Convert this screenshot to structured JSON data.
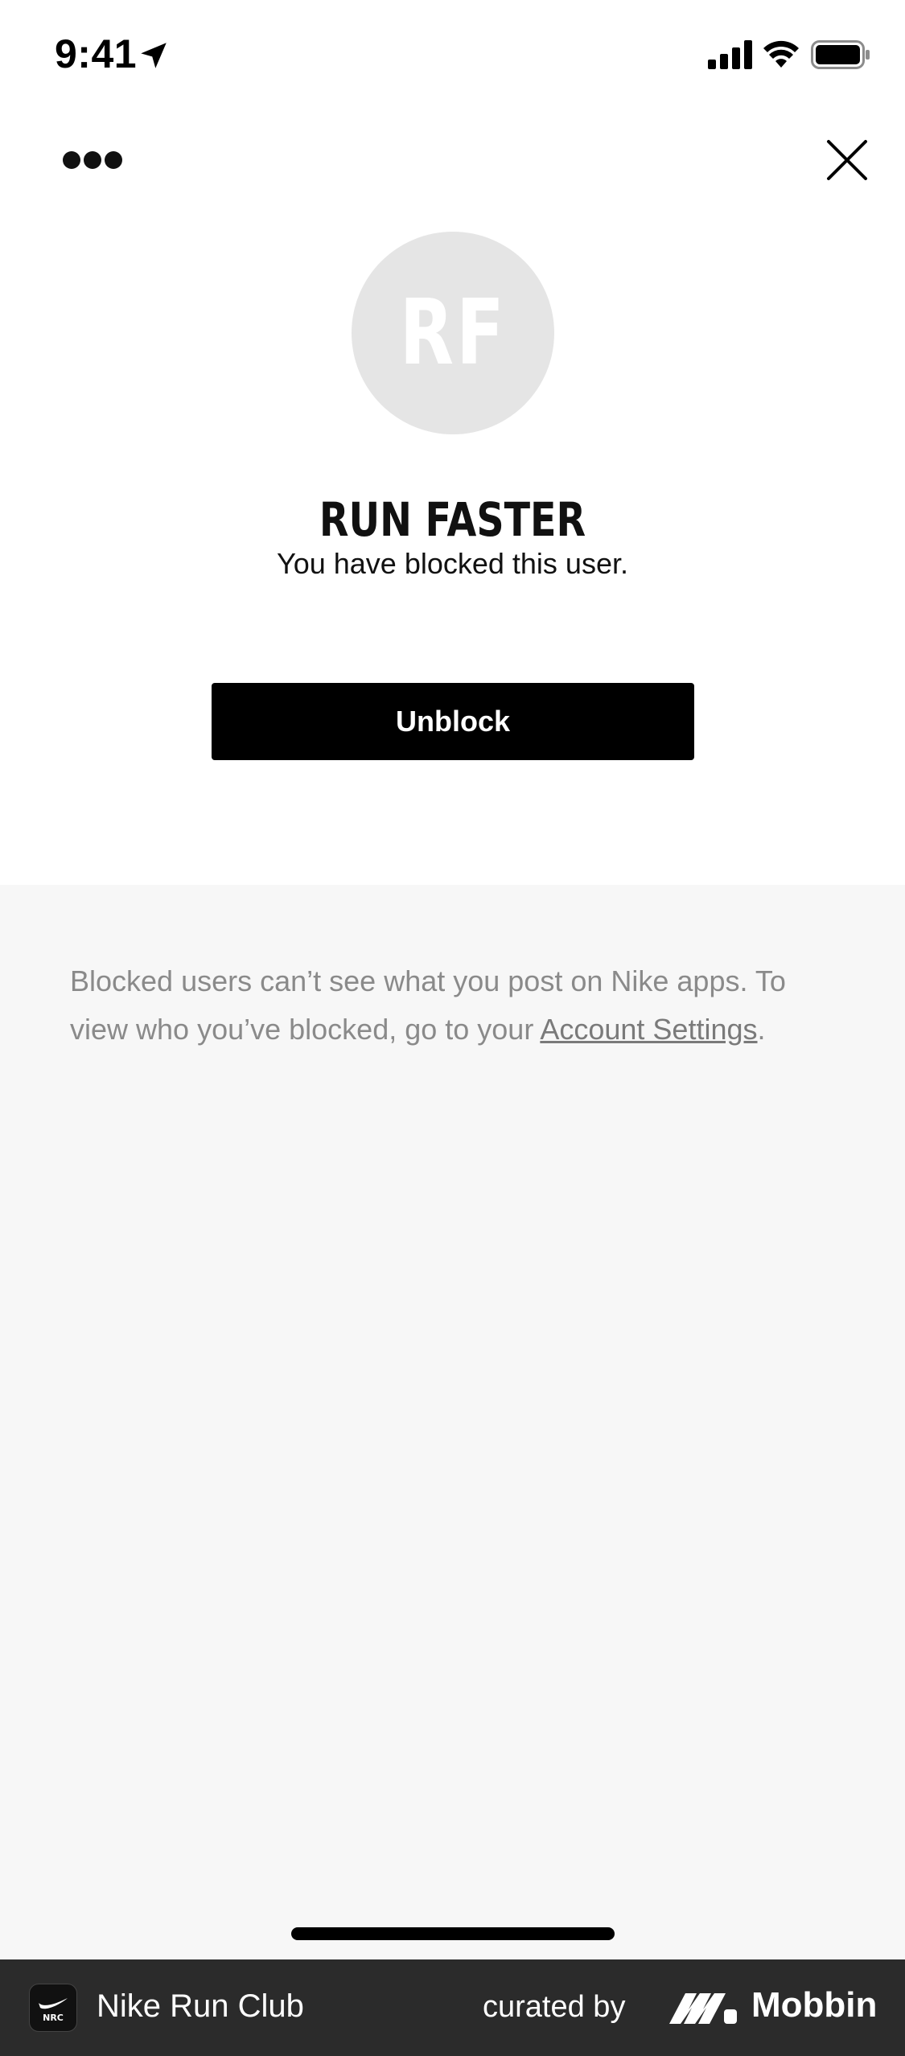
{
  "status_bar": {
    "time": "9:41",
    "location_icon": "location-arrow-icon",
    "signal_icon": "cellular-signal-icon",
    "wifi_icon": "wifi-icon",
    "battery_icon": "battery-icon"
  },
  "header": {
    "more_icon": "more-horizontal-icon",
    "close_icon": "close-icon"
  },
  "profile": {
    "initials": "RF",
    "name": "RUN FASTER",
    "message": "You have blocked this user."
  },
  "actions": {
    "unblock_label": "Unblock"
  },
  "info": {
    "text_before_link": "Blocked users can’t see what you post on Nike apps. To view who you’ve blocked, go to your ",
    "link_label": "Account Settings",
    "text_after_link": "."
  },
  "banner": {
    "app_name": "Nike Run Club",
    "app_icon_label": "NRC",
    "curated_label": "curated by",
    "brand_name": "Mobbin"
  },
  "colors": {
    "primary_button": "#000000",
    "panel_background": "#f7f7f7",
    "avatar_background": "#e5e5e5",
    "info_text": "#8a8a8a",
    "banner_background": "#2b2b2b"
  }
}
